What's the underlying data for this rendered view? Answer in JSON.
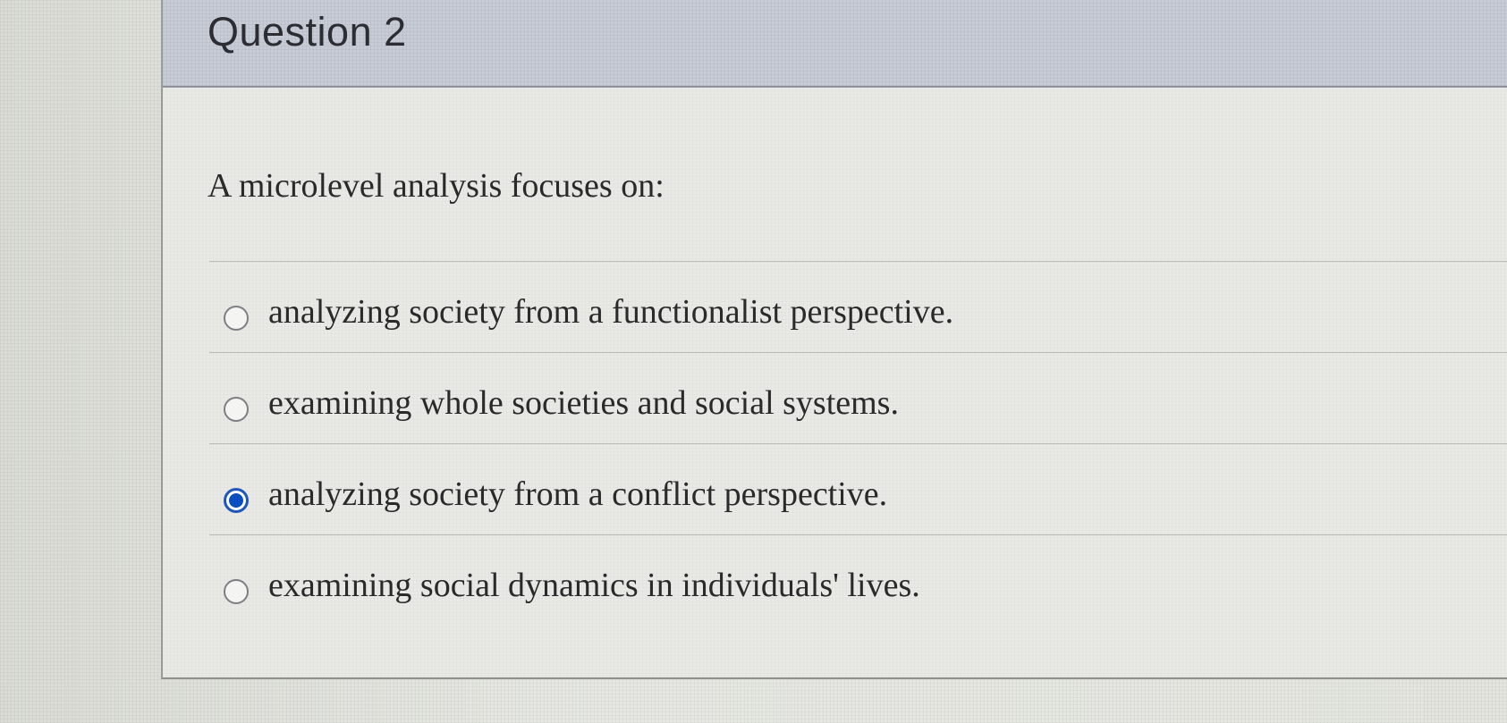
{
  "question": {
    "title": "Question 2",
    "prompt": "A microlevel analysis focuses on:",
    "options": [
      {
        "label": "analyzing society from a functionalist perspective.",
        "selected": false
      },
      {
        "label": "examining whole societies and social systems.",
        "selected": false
      },
      {
        "label": "analyzing society from a conflict perspective.",
        "selected": true
      },
      {
        "label": "examining social dynamics in individuals' lives.",
        "selected": false
      }
    ]
  },
  "colors": {
    "header_background": "#c6cbd6",
    "selected_radio": "#0b4ec2"
  }
}
